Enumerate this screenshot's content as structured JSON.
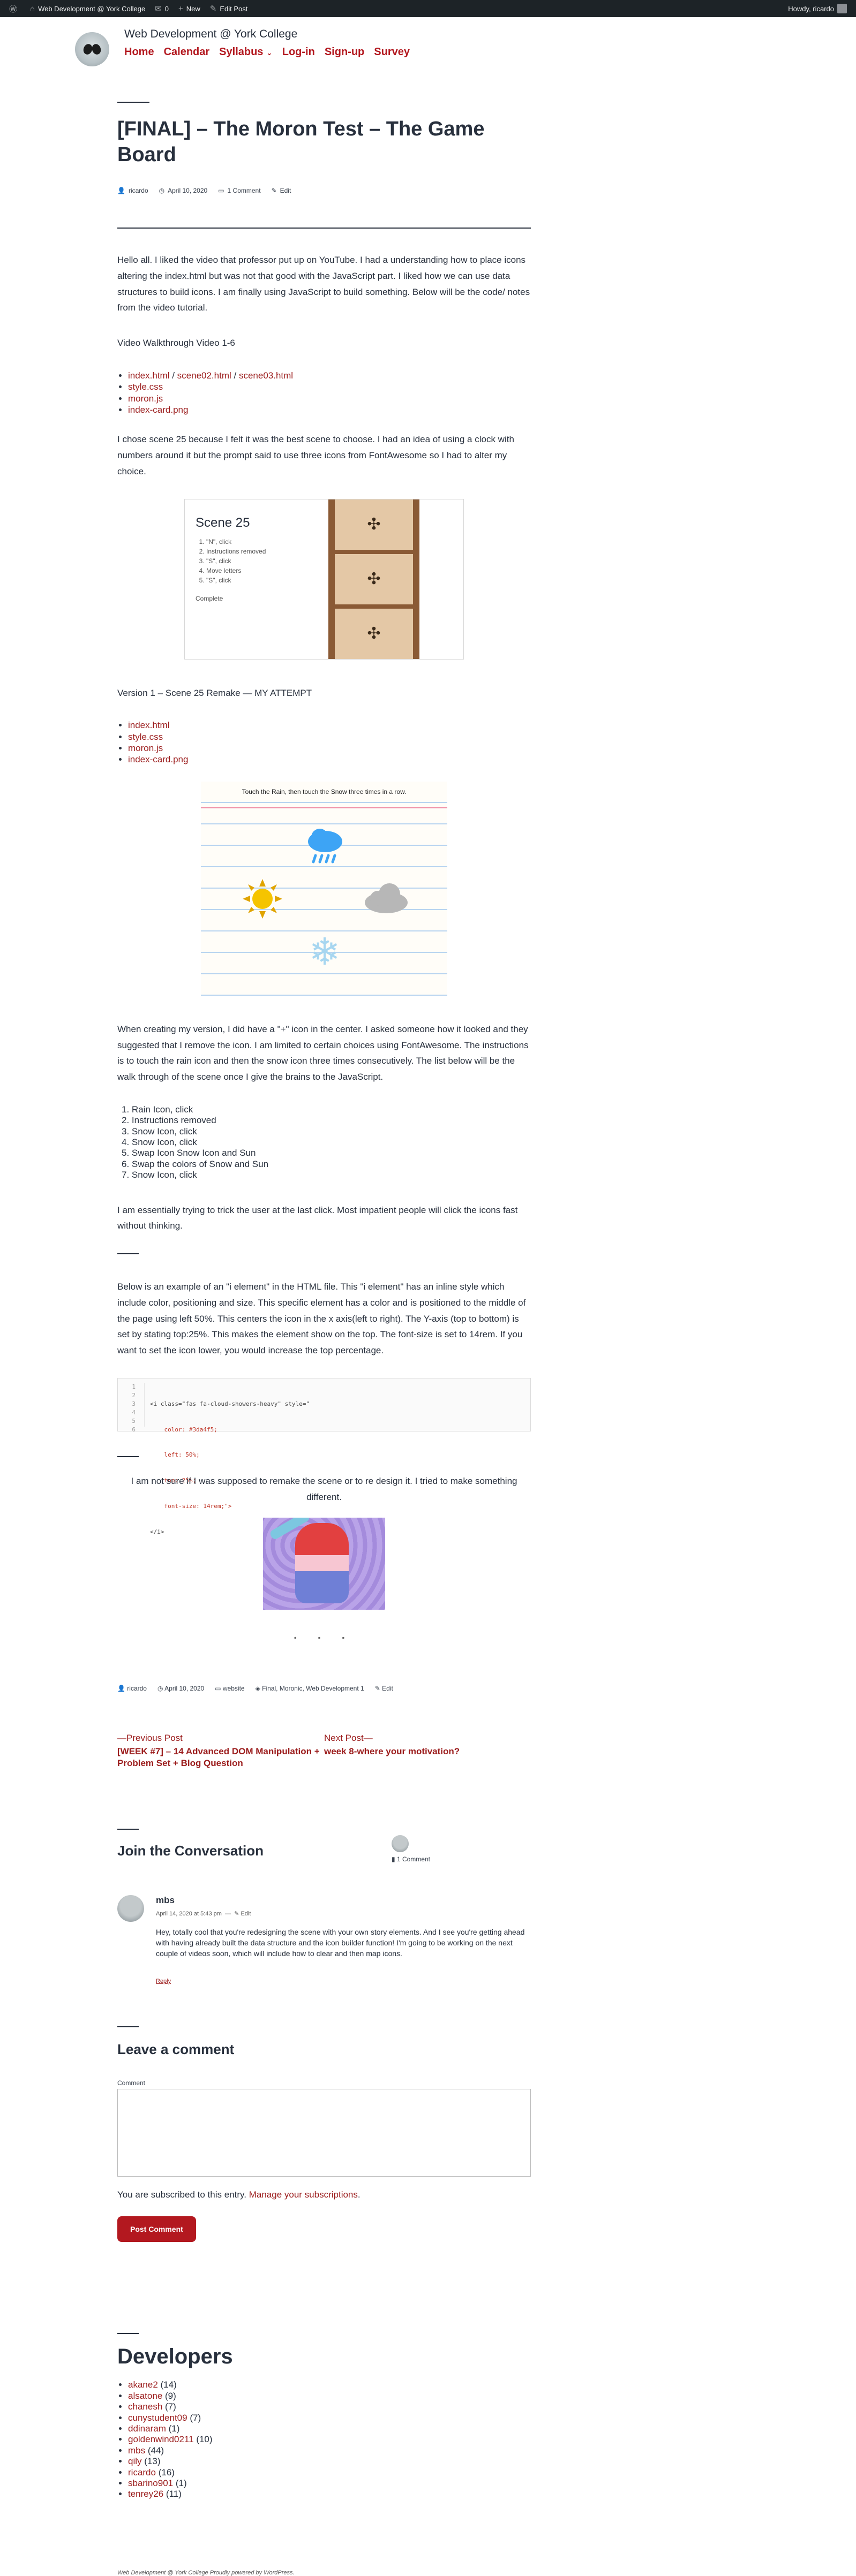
{
  "adminbar": {
    "site": "Web Development @ York College",
    "comments": "0",
    "new": "New",
    "edit_post": "Edit Post",
    "howdy": "Howdy, ricardo"
  },
  "header": {
    "site_title": "Web Development @ York College",
    "nav": [
      "Home",
      "Calendar",
      "Syllabus",
      "Log-in",
      "Sign-up",
      "Survey"
    ]
  },
  "post": {
    "title": "[FINAL] – The Moron Test – The Game Board",
    "author": "ricardo",
    "date": "April 10, 2020",
    "comments": "1 Comment",
    "edit": "Edit",
    "intro": "Hello all. I liked the video that professor put up on YouTube. I had a understanding how to place icons altering the index.html but was not that good with the JavaScript part. I liked how we can use data structures to build icons. I am finally using JavaScript to build something. Below will be the code/ notes from the video tutorial.",
    "walkthrough": "Video Walkthrough Video 1-6",
    "files1": {
      "a": "index.html",
      "sep": " / ",
      "b": "scene02.html",
      "c": "scene03.html",
      "d": "style.css",
      "e": "moron.js",
      "f": "index-card.png"
    },
    "scene_choice": "I chose scene 25 because I felt it was the best scene to choose. I had an idea of using a clock with numbers around it but the prompt said to use three icons from FontAwesome so I had to alter my choice.",
    "scene_card": {
      "title": "Scene 25",
      "steps": [
        "\"N\", click",
        "Instructions removed",
        "\"S\", click",
        "Move letters",
        "\"S\", click"
      ],
      "complete": "Complete"
    },
    "version_label": "Version 1 – Scene 25 Remake — MY ATTEMPT",
    "files2": [
      "index.html",
      "style.css",
      "moron.js",
      "index-card.png"
    ],
    "board_instruction": "Touch the Rain, then touch the Snow three times in a row.",
    "creating": "When creating my version, I did have a \"+\" icon in the center. I asked someone how it looked and they suggested that I remove the icon. I am limited to certain choices using FontAwesome. The instructions is to touch the rain icon and then the snow icon three times consecutively. The list below will be the walk through of the scene once I give the brains to the JavaScript.",
    "steps": [
      "1. Rain Icon, click",
      "2. Instructions removed",
      "3. Snow Icon, click",
      "4. Snow Icon, click",
      "5. Swap Icon Snow Icon and Sun",
      "6. Swap the colors of Snow and Sun",
      "7. Snow Icon, click"
    ],
    "trick": "I am essentially trying to trick the user at the last click. Most impatient people will click the icons fast without thinking.",
    "example": "Below is an example of an \"i element\" in the HTML file. This \"i element\" has an inline style which include color, positioning and size. This specific element has a color and is positioned to the middle of the page using left 50%. This centers the icon in the x axis(left to right). The Y-axis (top to bottom) is set by stating top:25%. This makes the element show on the top. The font-size is set to 14rem. If you want to set the icon lower, you would increase the top percentage.",
    "code_lines": [
      "<i class=\"fas fa-cloud-showers-heavy\" style=\"",
      "    color: #3da4f5;",
      "    left: 50%;",
      "    top: 25%;",
      "    font-size: 14rem;\">",
      "</i>"
    ],
    "code_nums": [
      "1",
      "2",
      "3",
      "4",
      "5",
      "6"
    ],
    "unsure": "I am not sure if I was supposed to remake the scene or to re design it. I tried to make something different.",
    "dots": "• • •",
    "categories": "website",
    "tags": "Final, Moronic, Web Development 1"
  },
  "post_nav": {
    "prev_label": "—Previous Post",
    "prev_title": "[WEEK #7] – 14 Advanced DOM Manipulation + Problem Set + Blog Question",
    "next_label": "Next Post—",
    "next_title": "week 8-where your motivation?"
  },
  "conversation": {
    "heading": "Join the Conversation",
    "count": "1 Comment"
  },
  "comment": {
    "author": "mbs",
    "date": "April 14, 2020 at 5:43 pm",
    "edit": "Edit",
    "text": "Hey, totally cool that you're redesigning the scene with your own story elements. And I see you're getting ahead with having already built the data structure and the icon builder function! I'm going to be working on the next couple of videos soon, which will include how to clear and then map icons.",
    "reply": "Reply"
  },
  "leave_comment": {
    "heading": "Leave a comment",
    "label": "Comment",
    "subscribed": "You are subscribed to this entry.",
    "manage": "Manage your subscriptions",
    "button": "Post Comment"
  },
  "developers": {
    "heading": "Developers",
    "list": [
      {
        "name": "akane2",
        "count": "(14)"
      },
      {
        "name": "alsatone",
        "count": "(9)"
      },
      {
        "name": "chanesh",
        "count": "(7)"
      },
      {
        "name": "cunystudent09",
        "count": "(7)"
      },
      {
        "name": "ddinaram",
        "count": "(1)"
      },
      {
        "name": "goldenwind0211",
        "count": "(10)"
      },
      {
        "name": "mbs",
        "count": "(44)"
      },
      {
        "name": "qily",
        "count": "(13)"
      },
      {
        "name": "ricardo",
        "count": "(16)"
      },
      {
        "name": "sbarino901",
        "count": "(1)"
      },
      {
        "name": "tenrey26",
        "count": "(11)"
      }
    ]
  },
  "footer": "Web Development @ York College Proudly powered by WordPress.",
  "colors": {
    "accent": "#b3181f",
    "adminbar": "#1d2327",
    "text": "#28303d"
  }
}
